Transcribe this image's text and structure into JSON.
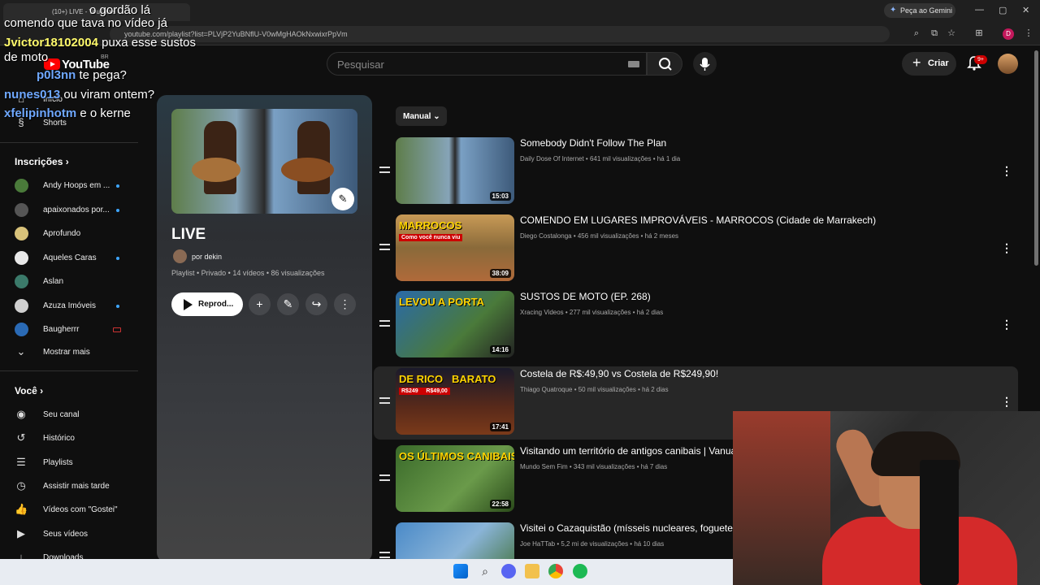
{
  "browser": {
    "tab_title": "(10+) LIVE - YouTube",
    "url": "youtube.com/playlist?list=PLVjP2YuBNflU-V0wMgHAOkNxwixrPpVm",
    "gemini_label": "Peça ao Gemini",
    "profile_letter": "D"
  },
  "header": {
    "logo_text": "YouTube",
    "country": "BR",
    "search_placeholder": "Pesquisar",
    "create_label": "Criar",
    "notif_count": "9+"
  },
  "sidebar": {
    "home": "Início",
    "shorts": "Shorts",
    "subs_title": "Inscrições",
    "subs": [
      {
        "label": "Andy Hoops em ...",
        "color": "#4a7a3a",
        "dot": true
      },
      {
        "label": "apaixonados por...",
        "color": "#555",
        "dot": true
      },
      {
        "label": "Aprofundo",
        "color": "#d8c27a",
        "dot": false
      },
      {
        "label": "Aqueles Caras",
        "color": "#e8e8e8",
        "dot": true
      },
      {
        "label": "Aslan",
        "color": "#3b7a6a",
        "dot": false
      },
      {
        "label": "Azuza Imóveis",
        "color": "#cfcfcf",
        "dot": true
      },
      {
        "label": "Baugherrr",
        "color": "#2a6ab5",
        "dot": false
      }
    ],
    "show_more": "Mostrar mais",
    "you_title": "Você",
    "you_items": [
      {
        "label": "Seu canal",
        "icon": "user-icon"
      },
      {
        "label": "Histórico",
        "icon": "history-icon"
      },
      {
        "label": "Playlists",
        "icon": "playlists-icon"
      },
      {
        "label": "Assistir mais tarde",
        "icon": "clock-icon"
      },
      {
        "label": "Vídeos com \"Gostei\"",
        "icon": "like-icon"
      },
      {
        "label": "Seus vídeos",
        "icon": "video-icon"
      },
      {
        "label": "Downloads",
        "icon": "download-icon"
      }
    ]
  },
  "playlist": {
    "title": "LIVE",
    "owner": "por dekin",
    "meta": "Playlist • Privado • 14 vídeos • 86 visualizações",
    "play_label": "Reprod..."
  },
  "sort_label": "Manual",
  "videos": [
    {
      "title": "Somebody Didn't Follow The Plan",
      "meta": "Daily Dose Of Internet • 641 mil visualizações • há 1 dia",
      "duration": "15:03",
      "bg": "linear-gradient(90deg,#5e7d4a,#86a4b8 45%,#2a2a2a 50%,#7aa0c4 55%,#3d5a7a)"
    },
    {
      "title": "COMENDO EM LUGARES IMPROVÁVEIS - MARROCOS (Cidade de Marrakech)",
      "meta": "Diego Costalonga • 456 mil visualizações • há 2 meses",
      "duration": "38:09",
      "bg": "linear-gradient(180deg,#c89a56,#8a6a3a 50%,#b06a3a)",
      "overlay": "MARROCOS",
      "sub": "Como você nunca viu"
    },
    {
      "title": "SUSTOS DE MOTO (EP. 268)",
      "meta": "Xracing Videos • 277 mil visualizações • há 2 dias",
      "duration": "14:16",
      "bg": "linear-gradient(135deg,#2a6aa8,#4a7a3a 60%,#222)",
      "overlay": "LEVOU A PORTA"
    },
    {
      "title": "Costela de R$:49,90 vs Costela de R$249,90!",
      "meta": "Thiago Quatroque • 50 mil visualizações • há 2 dias",
      "duration": "17:41",
      "bg": "linear-gradient(180deg,#1a1a2a,#5a2a1a 60%,#7a3a1a)",
      "overlay": "DE RICO   BARATO",
      "sub": "R$249     R$49,00"
    },
    {
      "title": "Visitando um território de antigos canibais | Vanua",
      "meta": "Mundo Sem Fim • 343 mil visualizações • há 7 dias",
      "duration": "22:58",
      "bg": "linear-gradient(135deg,#3a6a2a,#6a9a4a 60%,#2a4a1a)",
      "overlay": "OS ÚLTIMOS CANIBAIS"
    },
    {
      "title": "Visitei o Cazaquistão (mísseis nucleares, foguetes",
      "meta": "Joe HaTTab • 5,2 mi de visualizações • há 10 dias",
      "duration": "",
      "bg": "linear-gradient(135deg,#4a8ac8,#8ab4d8 50%,#3a6a2a)"
    }
  ],
  "chat": [
    {
      "user": "",
      "msg": "o gordão lá"
    },
    {
      "user": "",
      "msg": "comendo que tava no vídeo já"
    },
    {
      "user": "Jvictor18102004",
      "msg": "puxa esse sustos"
    },
    {
      "user": "",
      "msg": "de moto"
    },
    {
      "user": "p0l3nn",
      "msg": "te pega?"
    },
    {
      "user": "nunes013",
      "msg": "ou viram ontem?"
    },
    {
      "user": "xfelipinhotm",
      "msg": "e o kerne"
    }
  ],
  "colors": {
    "accent": "#ff0000",
    "bg": "#0f0f0f",
    "link": "#3ea6ff"
  }
}
